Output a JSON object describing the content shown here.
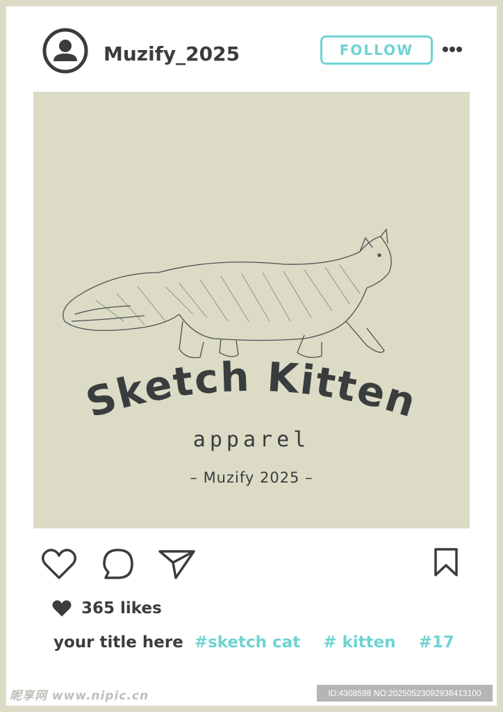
{
  "header": {
    "username": "Muzify_2025",
    "follow_label": "FOLLOW"
  },
  "post": {
    "brand_title": "Sketch Kitten",
    "brand_subtitle": "apparel",
    "brand_credit": "– Muzify 2025 –"
  },
  "engagement": {
    "likes": "365 likes"
  },
  "caption": {
    "title": "your title here",
    "hashtags": [
      "#sketch cat",
      "# kitten",
      "#17"
    ]
  },
  "watermark": {
    "logo": "昵享网 www.nipic.cn",
    "id_text": "ID:4308598 NO:20250523092938413100"
  },
  "colors": {
    "accent": "#6fd3d3",
    "ink": "#3a3d3d",
    "frame": "#dcdbc6"
  },
  "icons": [
    "user-avatar-icon",
    "more-dots-icon",
    "heart-icon",
    "comment-icon",
    "send-icon",
    "bookmark-icon",
    "heart-filled-icon"
  ]
}
